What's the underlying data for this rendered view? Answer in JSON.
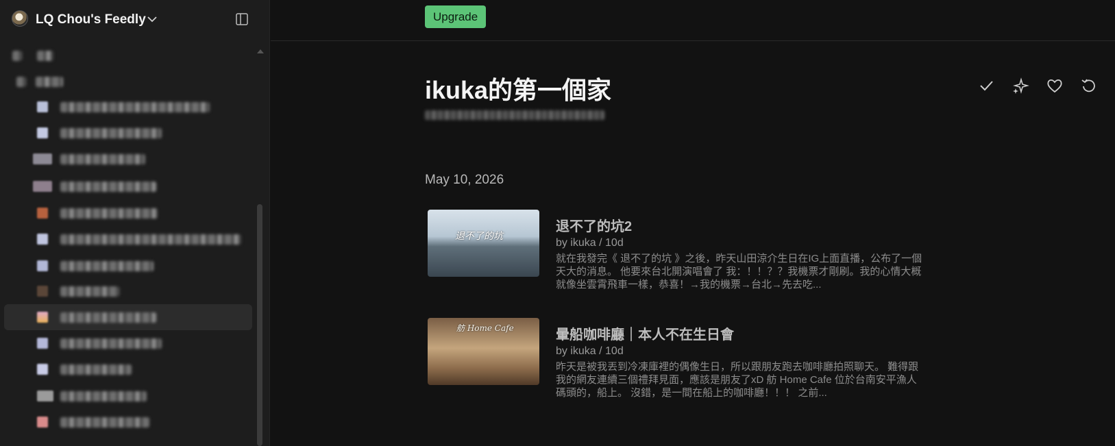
{
  "sidebar": {
    "workspace_title": "LQ Chou's Feedly",
    "toggle_icon": "sidebar-panel-icon",
    "chevron_icon": "chevron-down-icon"
  },
  "topbar": {
    "upgrade_label": "Upgrade"
  },
  "feed": {
    "title": "ikuka的第一個家"
  },
  "actions": [
    "check-icon",
    "sparkle-icon",
    "heart-icon",
    "refresh-icon"
  ],
  "date_heading": "May 10, 2026",
  "articles": [
    {
      "title": "退不了的坑2",
      "meta": "by ikuka / 10d",
      "snippet": "就在我發完《 退不了的坑 》之後，昨天山田涼介生日在IG上面直播，公布了一個天大的消息。 他要來台北開演唱會了 我：！！？？我機票才剛刷。我的心情大概就像坐雲霄飛車一樣，恭喜！→我的機票→台北→先去吃...",
      "thumb_text": "退不了的坑"
    },
    {
      "title": "暈船咖啡廳｜本人不在生日會",
      "meta": "by ikuka / 10d",
      "snippet": "昨天是被我丟到冷凍庫裡的偶像生日，所以跟朋友跑去咖啡廳拍照聊天。 難得跟我的網友連續三個禮拜見面，應該是朋友了xD 舫 Home Cafe 位於台南安平漁人碼頭的，船上。 沒錯，是一間在船上的咖啡廳！！！ 之前...",
      "thumb_text": "舫 Home Cafe"
    }
  ],
  "colors": {
    "accent_green": "#5cc477",
    "background": "#121212",
    "sidebar": "#1d1d1d"
  }
}
